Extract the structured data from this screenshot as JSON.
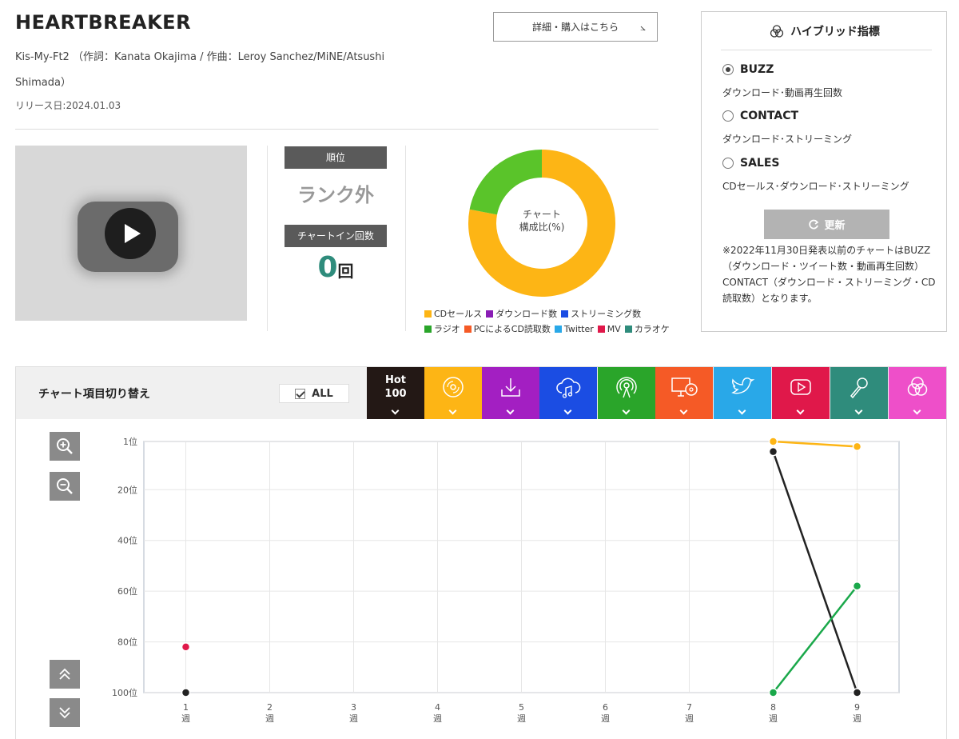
{
  "song": {
    "title": "HEARTBREAKER",
    "credit_line1": "Kis-My-Ft2 （作詞：Kanata Okajima / 作曲：Leroy Sanchez/MiNE/Atsushi",
    "credit_line2": "Shimada）",
    "release": "リリース日:2024.01.03"
  },
  "detail_button": {
    "label": "詳細・購入はこちら",
    "arrow": "⦣"
  },
  "video": {
    "icon": "play-icon"
  },
  "rank": {
    "label": "順位",
    "value": "ランク外",
    "chartin_label": "チャートイン回数",
    "chartin_count": "0",
    "chartin_unit": "回"
  },
  "composition": {
    "center_line1": "チャート",
    "center_line2": "構成比(%)",
    "slices": [
      {
        "name": "CDセールス",
        "value": 78,
        "color": "#fdb515"
      },
      {
        "name": "ラジオ",
        "value": 22,
        "color": "#5ac42a"
      }
    ],
    "legend_row1": [
      {
        "name": "CDセールス",
        "color": "#fdb515"
      },
      {
        "name": "ダウンロード数",
        "color": "#8a1db5"
      },
      {
        "name": "ストリーミング数",
        "color": "#1b4de3"
      }
    ],
    "legend_row2": [
      {
        "name": "ラジオ",
        "color": "#2aa52a"
      },
      {
        "name": "PCによるCD読取数",
        "color": "#f55a26"
      },
      {
        "name": "Twitter",
        "color": "#29a8e8"
      },
      {
        "name": "MV",
        "color": "#e0184a"
      },
      {
        "name": "カラオケ",
        "color": "#2f8c7c"
      }
    ]
  },
  "hybrid": {
    "title": "ハイブリッド指標",
    "options": [
      {
        "label": "BUZZ",
        "desc": "ダウンロード･動画再生回数",
        "selected": true
      },
      {
        "label": "CONTACT",
        "desc": "ダウンロード･ストリーミング",
        "selected": false
      },
      {
        "label": "SALES",
        "desc": "CDセールス･ダウンロード･ストリーミング",
        "selected": false
      }
    ],
    "refresh_label": "更新",
    "note": "※2022年11月30日発表以前のチャートはBUZZ（ダウンロード・ツイート数・動画再生回数）CONTACT（ダウンロード・ストリーミング・CD読取数）となります。"
  },
  "chart_section": {
    "switch_label": "チャート項目切り替え",
    "all_label": "ALL",
    "tabs": [
      {
        "name": "hot100",
        "label1": "Hot",
        "label2": "100",
        "color": "#231815"
      },
      {
        "name": "cd-sales",
        "icon": "cd-icon",
        "color": "#fdb515"
      },
      {
        "name": "download",
        "icon": "download-icon",
        "color": "#a31fc2"
      },
      {
        "name": "streaming",
        "icon": "cloud-music-icon",
        "color": "#1b4de3"
      },
      {
        "name": "radio",
        "icon": "radio-icon",
        "color": "#2aa52a"
      },
      {
        "name": "pc-cd-read",
        "icon": "pc-cd-icon",
        "color": "#f55a26"
      },
      {
        "name": "twitter",
        "icon": "twitter-icon",
        "color": "#29a8e8"
      },
      {
        "name": "mv",
        "icon": "youtube-icon",
        "color": "#e0184a"
      },
      {
        "name": "karaoke",
        "icon": "microphone-icon",
        "color": "#2f8c7c"
      },
      {
        "name": "hybrid",
        "icon": "hybrid-icon",
        "color": "#ee4fc9"
      }
    ]
  },
  "chart_data": {
    "type": "line",
    "x": [
      1,
      2,
      3,
      4,
      5,
      6,
      7,
      8,
      9
    ],
    "x_tick_labels": [
      "1\n週",
      "2\n週",
      "3\n週",
      "4\n週",
      "5\n週",
      "6\n週",
      "7\n週",
      "8\n週",
      "9\n週"
    ],
    "y_tick_labels": [
      "1位",
      "20位",
      "40位",
      "60位",
      "80位",
      "100位"
    ],
    "y_ticks": [
      1,
      20,
      40,
      60,
      80,
      100
    ],
    "ylim": [
      1,
      100
    ],
    "y_inverted": true,
    "grid": true,
    "series": [
      {
        "color": "#fdb515",
        "points": [
          [
            8,
            1
          ],
          [
            9,
            3
          ]
        ]
      },
      {
        "color": "#222222",
        "points": [
          [
            1,
            100
          ],
          [
            8,
            5
          ],
          [
            9,
            100
          ]
        ]
      },
      {
        "color": "#1aa84a",
        "points": [
          [
            8,
            100
          ],
          [
            9,
            58
          ]
        ]
      },
      {
        "color": "#e0184a",
        "points": [
          [
            1,
            82
          ]
        ]
      }
    ],
    "line_segments": [
      {
        "color": "#fdb515",
        "from": [
          8,
          1
        ],
        "to": [
          9,
          3
        ]
      },
      {
        "color": "#222222",
        "from": [
          8,
          5
        ],
        "to": [
          9,
          100
        ]
      },
      {
        "color": "#1aa84a",
        "from": [
          8,
          100
        ],
        "to": [
          9,
          58
        ]
      }
    ]
  }
}
